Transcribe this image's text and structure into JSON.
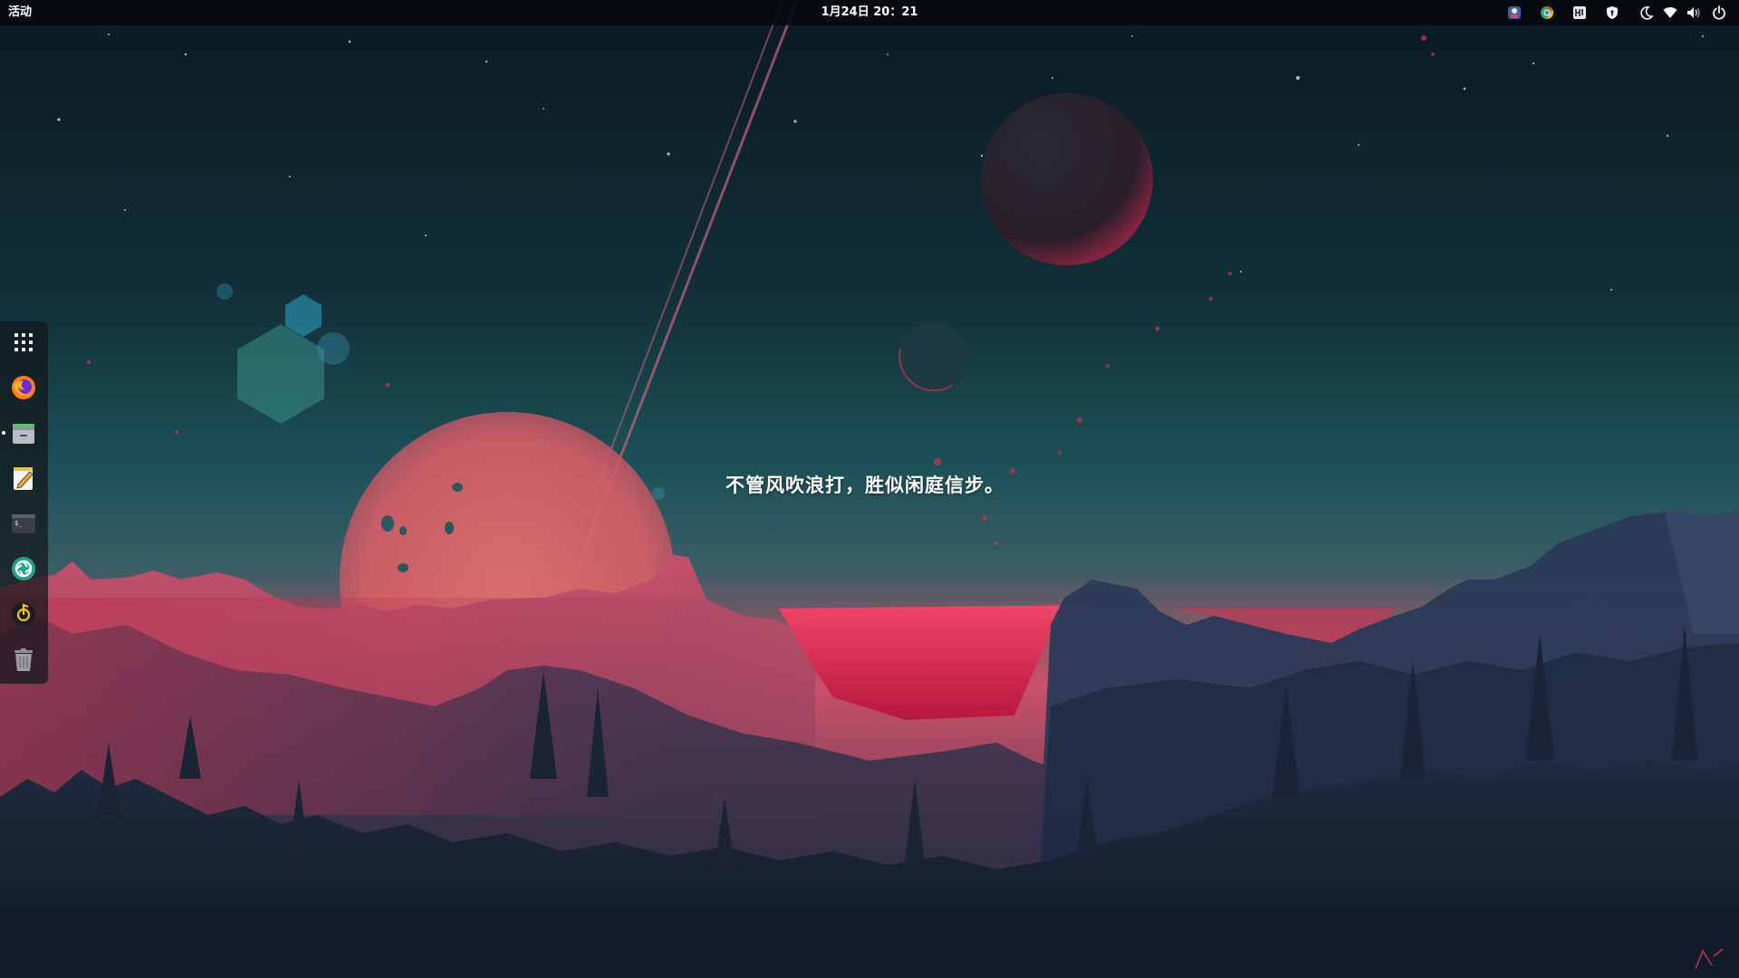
{
  "topbar": {
    "activities_label": "活动",
    "clock_text": "1月24日 20：21",
    "tray_icons": [
      "avatar-app-icon",
      "chrome-browser-icon",
      "input-method-icon",
      "vpn-shield-icon",
      "night-light-icon",
      "wifi-icon",
      "volume-icon",
      "power-icon"
    ]
  },
  "dock": {
    "items": [
      {
        "name": "show-applications",
        "icon": "grid-icon",
        "running": false
      },
      {
        "name": "firefox",
        "icon": "firefox-icon",
        "running": false
      },
      {
        "name": "file-manager",
        "icon": "file-cabinet-icon",
        "running": true
      },
      {
        "name": "text-editor",
        "icon": "text-editor-icon",
        "running": false
      },
      {
        "name": "terminal",
        "icon": "terminal-icon",
        "running": false
      },
      {
        "name": "shutter",
        "icon": "aperture-icon",
        "running": false
      },
      {
        "name": "music-player",
        "icon": "music-note-icon",
        "running": false
      },
      {
        "name": "trash",
        "icon": "trash-icon",
        "running": false
      }
    ]
  },
  "desktop": {
    "quote": "不管风吹浪打，胜似闲庭信步。"
  },
  "colors": {
    "sky_top": "#0c1b26",
    "sky_mid": "#18454f",
    "horizon": "#d8566c",
    "sea": "#e0234c",
    "forest": "#1b2436",
    "panel": "#08090c"
  }
}
